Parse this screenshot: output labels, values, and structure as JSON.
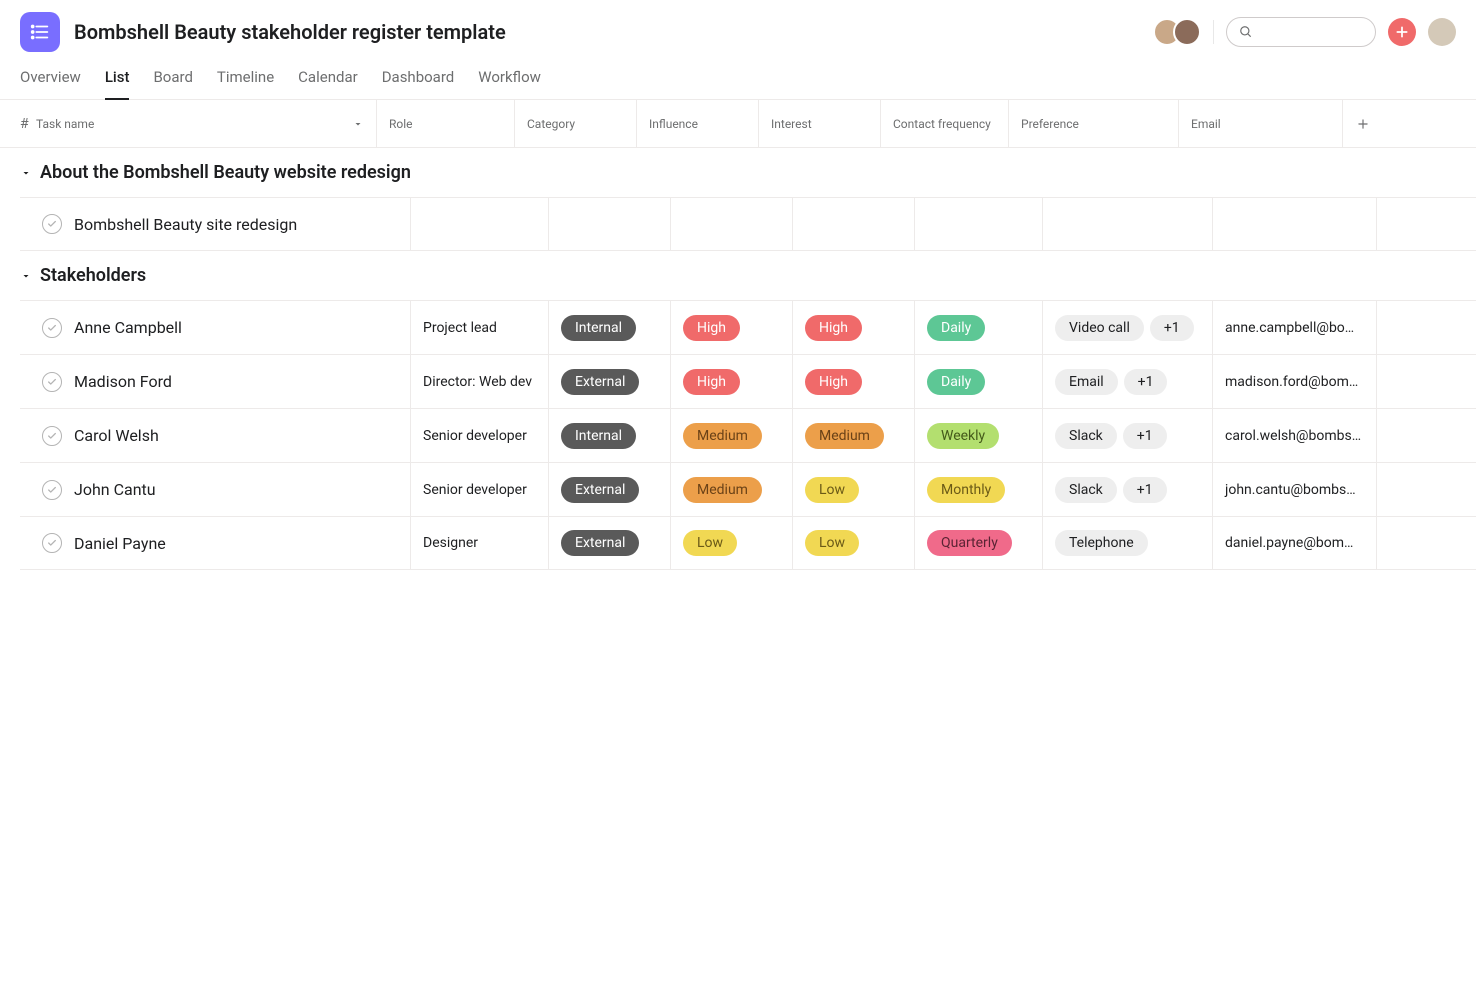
{
  "project": {
    "title": "Bombshell Beauty stakeholder register template"
  },
  "tabs": [
    "Overview",
    "List",
    "Board",
    "Timeline",
    "Calendar",
    "Dashboard",
    "Workflow"
  ],
  "activeTab": "List",
  "columns": {
    "hash": "#",
    "task": "Task name",
    "role": "Role",
    "category": "Category",
    "influence": "Influence",
    "interest": "Interest",
    "frequency": "Contact frequency",
    "preference": "Preference",
    "email": "Email"
  },
  "sections": [
    {
      "title": "About the Bombshell Beauty website redesign",
      "rows": [
        {
          "name": "Bombshell Beauty site redesign",
          "role": "",
          "category": "",
          "influence": "",
          "interest": "",
          "frequency": "",
          "preference": "",
          "prefExtra": "",
          "email": ""
        }
      ]
    },
    {
      "title": "Stakeholders",
      "rows": [
        {
          "name": "Anne Campbell",
          "role": "Project lead",
          "category": "Internal",
          "influence": "High",
          "interest": "High",
          "frequency": "Daily",
          "preference": "Video call",
          "prefExtra": "+1",
          "email": "anne.campbell@bo…"
        },
        {
          "name": "Madison Ford",
          "role": "Director: Web dev",
          "category": "External",
          "influence": "High",
          "interest": "High",
          "frequency": "Daily",
          "preference": "Email",
          "prefExtra": "+1",
          "email": "madison.ford@bom…"
        },
        {
          "name": "Carol Welsh",
          "role": "Senior developer",
          "category": "Internal",
          "influence": "Medium",
          "interest": "Medium",
          "frequency": "Weekly",
          "preference": "Slack",
          "prefExtra": "+1",
          "email": "carol.welsh@bombs…"
        },
        {
          "name": "John Cantu",
          "role": "Senior developer",
          "category": "External",
          "influence": "Medium",
          "interest": "Low",
          "frequency": "Monthly",
          "preference": "Slack",
          "prefExtra": "+1",
          "email": "john.cantu@bombs…"
        },
        {
          "name": "Daniel Payne",
          "role": "Designer",
          "category": "External",
          "influence": "Low",
          "interest": "Low",
          "frequency": "Quarterly",
          "preference": "Telephone",
          "prefExtra": "",
          "email": "daniel.payne@bom…"
        }
      ]
    }
  ],
  "tagStyles": {
    "Internal": "pill-dark",
    "External": "pill-dark",
    "High": "pill-red-txtw",
    "Medium": "pill-orange",
    "Low": "pill-yellow",
    "Daily": "pill-green-txtw",
    "Weekly": "pill-lime",
    "Monthly": "pill-yellow",
    "Quarterly": "pill-pink",
    "Video call": "pill-gray",
    "Email": "pill-gray",
    "Slack": "pill-gray",
    "Telephone": "pill-gray",
    "+1": "pill-gray"
  }
}
